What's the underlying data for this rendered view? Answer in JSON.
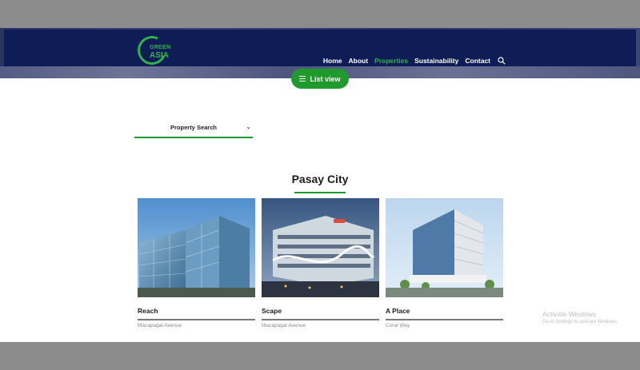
{
  "nav": {
    "logo_line1": "GREEN",
    "logo_line2": "ASIA",
    "items": [
      {
        "label": "Home",
        "active": false
      },
      {
        "label": "About",
        "active": false
      },
      {
        "label": "Properties",
        "active": true
      },
      {
        "label": "Sustainability",
        "active": false
      },
      {
        "label": "Contact",
        "active": false
      }
    ],
    "search_icon": "search-icon",
    "accent_color": "#2fb34a",
    "navbar_color": "#0f1d57"
  },
  "list_view_button": {
    "label": "List view",
    "icon": "list-icon"
  },
  "property_search": {
    "label": "Property Search",
    "icon": "chevron-down-icon"
  },
  "section": {
    "title": "Pasay City",
    "cards": [
      {
        "name": "Reach",
        "address": "Macapagal Avenue"
      },
      {
        "name": "Scape",
        "address": "Macapagal Avenue"
      },
      {
        "name": "A Place",
        "address": "Coral Way"
      }
    ]
  },
  "watermark": {
    "title": "Activate Windows",
    "subtitle": "Go to Settings to activate Windows."
  }
}
